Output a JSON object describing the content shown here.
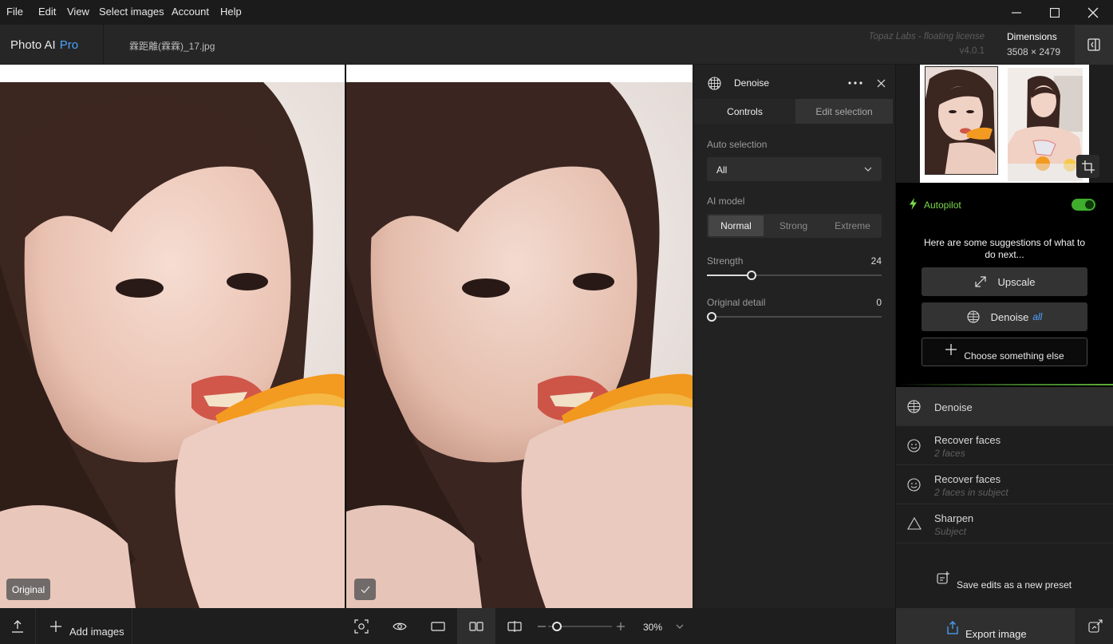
{
  "menubar": {
    "items": [
      "File",
      "Edit",
      "View",
      "Select images",
      "Account",
      "Help"
    ]
  },
  "header": {
    "app_name": "Photo AI",
    "app_edition": "Pro",
    "filename": "霖距離(霖霖)_17.jpg",
    "license": "Topaz Labs - floating license",
    "version": "v4.0.1",
    "dimensions_label": "Dimensions",
    "dimensions_value": "3508 × 2479"
  },
  "viewer": {
    "left_tag": "Original",
    "right_tag_icon": "checkmark-icon"
  },
  "bottombar": {
    "add_images_label": "Add images",
    "zoom_level": "30%",
    "zoom_fraction": 0.08
  },
  "controls": {
    "title": "Denoise",
    "tabs": [
      "Controls",
      "Edit selection"
    ],
    "active_tab": "Controls",
    "auto_selection_label": "Auto selection",
    "auto_selection_value": "All",
    "ai_model_label": "AI model",
    "ai_models": [
      "Normal",
      "Strong",
      "Extreme"
    ],
    "ai_model_selected": "Normal",
    "strength_label": "Strength",
    "strength_value": "24",
    "strength_fraction": 0.24,
    "detail_label": "Original detail",
    "detail_value": "0",
    "detail_fraction": 0.0
  },
  "rightpanel": {
    "autopilot_label": "Autopilot",
    "autopilot_enabled": true,
    "suggestion_text": "Here are some suggestions of what to do next...",
    "suggestions": {
      "upscale": "Upscale",
      "denoise": "Denoise",
      "denoise_scope": "all",
      "choose": "Choose something else"
    },
    "filters": [
      {
        "title": "Denoise",
        "subtitle": "",
        "icon": "denoise-icon"
      },
      {
        "title": "Recover faces",
        "subtitle": "2 faces",
        "icon": "face-icon"
      },
      {
        "title": "Recover faces",
        "subtitle": "2 faces in subject",
        "icon": "face-icon"
      },
      {
        "title": "Sharpen",
        "subtitle": "Subject",
        "icon": "sharpen-icon"
      }
    ],
    "save_preset_label": "Save edits as a new preset",
    "export_label": "Export image"
  },
  "colors": {
    "accent_blue": "#4aa3ff",
    "autopilot_green": "#7cd84a",
    "toggle_green": "#3fae2c"
  }
}
